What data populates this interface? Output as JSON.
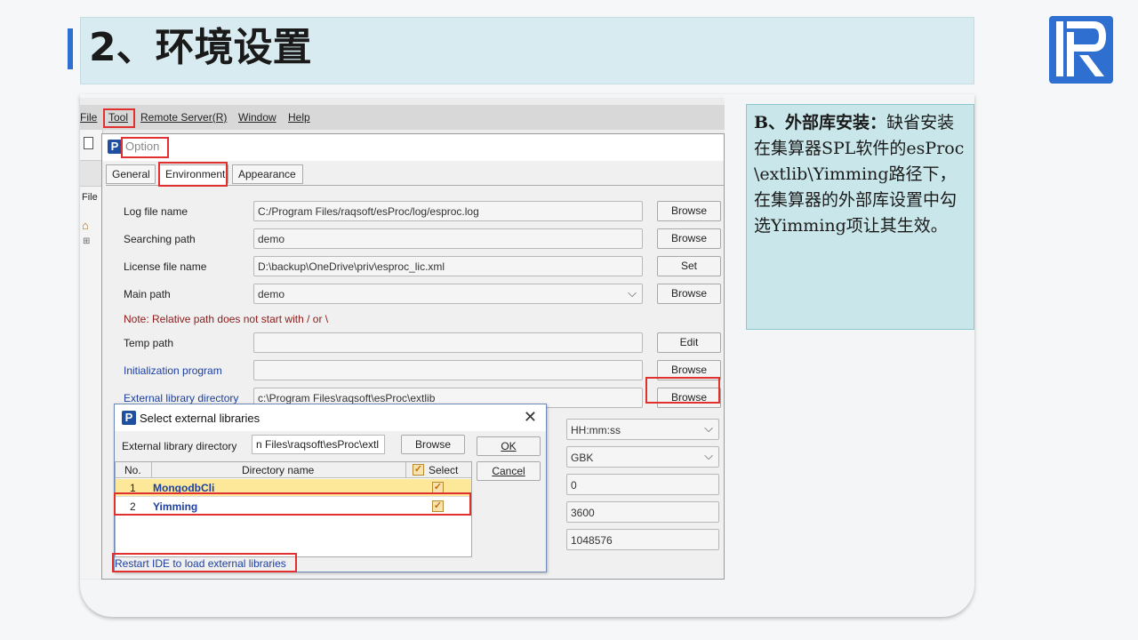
{
  "slide": {
    "title": "2、环境设置",
    "note_heading": "B、外部库安装：",
    "note_body": "缺省安装在集算器SPL软件的esProc\\extlib\\Yimming路径下，在集算器的外部库设置中勾选Yimming项让其生效。"
  },
  "colors": {
    "accent": "#2f6fd0",
    "title_band": "#d8ebf0",
    "note_bg": "#c9e7ea",
    "highlight": "#e03030"
  },
  "menubar": {
    "file": "File",
    "tool": "Tool",
    "remote": "Remote Server(R)",
    "window": "Window",
    "help": "Help"
  },
  "sidebar": {
    "file_label": "File"
  },
  "option_dialog": {
    "title": "Option",
    "tabs": [
      "General",
      "Environment",
      "Appearance"
    ],
    "fields": {
      "log_label": "Log file name",
      "log_value": "C:/Program Files/raqsoft/esProc/log/esproc.log",
      "log_button": "Browse",
      "search_label": "Searching path",
      "search_value": "demo",
      "search_button": "Browse",
      "license_label": "License file name",
      "license_value": "D:\\backup\\OneDrive\\priv\\esproc_lic.xml",
      "license_button": "Set",
      "main_label": "Main path",
      "main_value": "demo",
      "main_button": "Browse",
      "note": "Note: Relative path does not start with / or \\",
      "temp_label": "Temp path",
      "temp_value": "",
      "temp_button": "Edit",
      "init_label": "Initialization program",
      "init_value": "",
      "init_button": "Browse",
      "extlib_label": "External library directory",
      "extlib_value": "c:\\Program Files\\raqsoft\\esProc\\extlib",
      "extlib_button": "Browse"
    },
    "right_fields": [
      "HH:mm:ss",
      "GBK",
      "0",
      "3600",
      "1048576"
    ]
  },
  "extlib_dialog": {
    "title": "Select external libraries",
    "close": "✕",
    "dir_label": "External library directory",
    "dir_value": "n Files\\raqsoft\\esProc\\extl",
    "browse": "Browse",
    "ok": "OK",
    "cancel": "Cancel",
    "columns": {
      "no": "No.",
      "name": "Directory name",
      "select": "Select"
    },
    "rows": [
      {
        "no": "1",
        "name": "MongodbCli",
        "selected": true
      },
      {
        "no": "2",
        "name": "Yimming",
        "selected": true
      }
    ],
    "footer": "Restart IDE to load external libraries"
  }
}
